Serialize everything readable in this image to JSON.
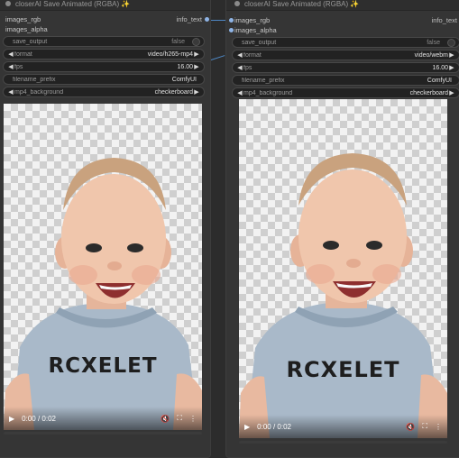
{
  "nodes": [
    {
      "title": "closerAI Save Animated (RGBA) ✨",
      "inputs": [
        "images_rgb",
        "images_alpha"
      ],
      "output": "info_text",
      "widgets": {
        "save_output": {
          "label": "save_output",
          "value": "false"
        },
        "format": {
          "label": "format",
          "value": "video/h265-mp4"
        },
        "fps": {
          "label": "fps",
          "value": "16.00"
        },
        "filename_prefix": {
          "label": "filename_prefix",
          "value": "ComfyUI"
        },
        "mp4_background": {
          "label": "mp4_background",
          "value": "checkerboard"
        }
      },
      "player": {
        "time": "0:00 / 0:02",
        "progress": 0.0
      }
    },
    {
      "title": "closerAI Save Animated (RGBA) ✨",
      "inputs": [
        "images_rgb",
        "images_alpha"
      ],
      "output": "info_text",
      "widgets": {
        "save_output": {
          "label": "save_output",
          "value": "false"
        },
        "format": {
          "label": "format",
          "value": "video/webm"
        },
        "fps": {
          "label": "fps",
          "value": "16.00"
        },
        "filename_prefix": {
          "label": "filename_prefix",
          "value": "ComfyUI"
        },
        "mp4_background": {
          "label": "mp4_background",
          "value": "checkerboard"
        }
      },
      "player": {
        "time": "0:00 / 0:02",
        "progress": 0.0
      }
    }
  ],
  "shirt_text": "RCXELET",
  "icons": {
    "play": "play-icon",
    "mute": "volume-muted-icon",
    "fullscreen": "fullscreen-icon",
    "more": "more-vertical-icon",
    "arrow_left": "arrow-left-icon",
    "arrow_right": "arrow-right-icon"
  },
  "colors": {
    "link": "#4e87c4",
    "input_slot": "#8fb4e6",
    "node_bg": "#353535",
    "canvas_bg": "#2c2c2c"
  }
}
